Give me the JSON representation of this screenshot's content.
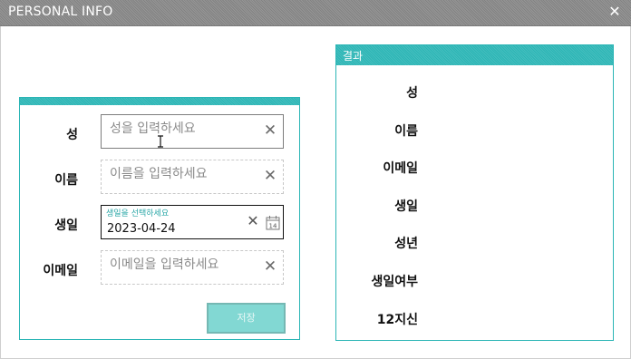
{
  "window": {
    "title": "PERSONAL INFO",
    "close_glyph": "✕"
  },
  "form": {
    "fields": [
      {
        "label": "성",
        "placeholder": "성을 입력하세요",
        "clear_glyph": "✕"
      },
      {
        "label": "이름",
        "placeholder": "이름을 입력하세요",
        "clear_glyph": "✕"
      },
      {
        "label": "생일",
        "hint": "생일을 선택하세요",
        "value": "2023-04-24",
        "clear_glyph": "✕",
        "calendar_day": "14"
      },
      {
        "label": "이메일",
        "placeholder": "이메일을 입력하세요",
        "clear_glyph": "✕"
      }
    ],
    "save_label": "저장"
  },
  "result": {
    "title": "결과",
    "labels": [
      "성",
      "이름",
      "이메일",
      "생일",
      "성년",
      "생일여부",
      "12지신"
    ]
  },
  "colors": {
    "accent": "#2bb5b5",
    "save_button": "#82d8d3",
    "titlebar": "#8a8a8a"
  },
  "icons": [
    "close-icon",
    "clear-icon",
    "calendar-icon",
    "text-cursor-icon"
  ]
}
